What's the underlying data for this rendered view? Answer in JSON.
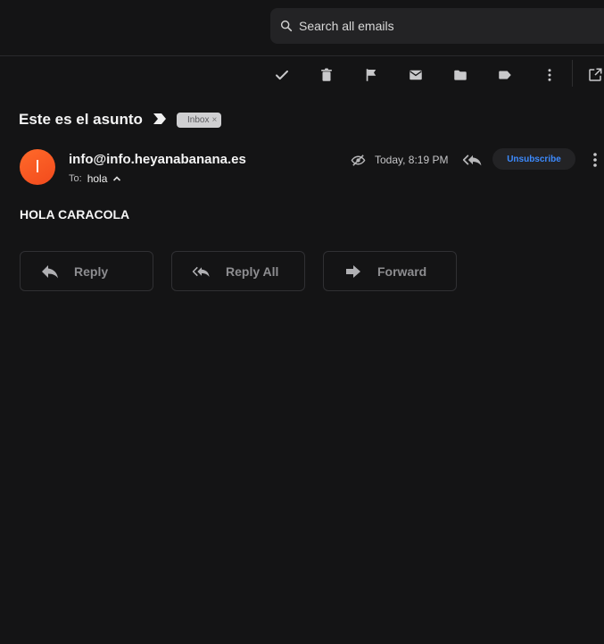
{
  "search": {
    "placeholder": "Search all emails"
  },
  "toolbar": {
    "icons": [
      "check-icon",
      "trash-icon",
      "flag-icon",
      "envelope-icon",
      "folder-icon",
      "tag-icon",
      "more-vertical-icon",
      "open-external-icon"
    ]
  },
  "email": {
    "subject": "Este es el asunto",
    "label_badge": "Inbox",
    "label_badge_remove": "×",
    "avatar_initial": "I",
    "sender": "info@info.heyanabanana.es",
    "to_label": "To:",
    "to_name": "hola",
    "time": "Today, 8:19 PM",
    "unsubscribe_label": "Unsubscribe",
    "body": "HOLA CARACOLA"
  },
  "actions": {
    "reply": "Reply",
    "reply_all": "Reply All",
    "forward": "Forward"
  },
  "colors": {
    "background": "#141415",
    "accent": "#3d8bff",
    "avatar": "#ff5a22"
  }
}
